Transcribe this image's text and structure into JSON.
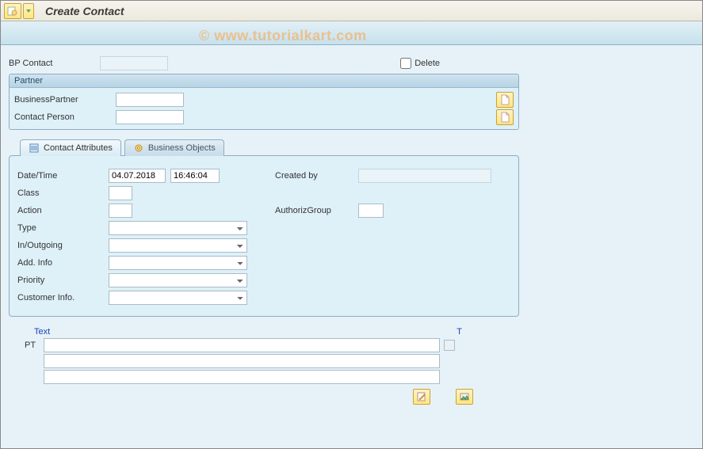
{
  "title": "Create Contact",
  "watermark": "© www.tutorialkart.com",
  "header": {
    "bp_contact_label": "BP Contact",
    "bp_contact_value": "",
    "delete_label": "Delete"
  },
  "partner": {
    "legend": "Partner",
    "business_partner_label": "BusinessPartner",
    "business_partner_value": "",
    "contact_person_label": "Contact Person",
    "contact_person_value": ""
  },
  "tabs": {
    "contact_attributes": "Contact Attributes",
    "business_objects": "Business Objects"
  },
  "attrs": {
    "datetime_label": "Date/Time",
    "date_value": "04.07.2018",
    "time_value": "16:46:04",
    "created_by_label": "Created by",
    "created_by_value": "",
    "class_label": "Class",
    "class_value": "",
    "action_label": "Action",
    "action_value": "",
    "authoriz_label": "AuthorizGroup",
    "authoriz_value": "",
    "type_label": "Type",
    "inout_label": "In/Outgoing",
    "addinfo_label": "Add. Info",
    "priority_label": "Priority",
    "custinfo_label": "Customer Info."
  },
  "textarea": {
    "header_text": "Text",
    "header_t": "T",
    "pt_label": "PT"
  }
}
